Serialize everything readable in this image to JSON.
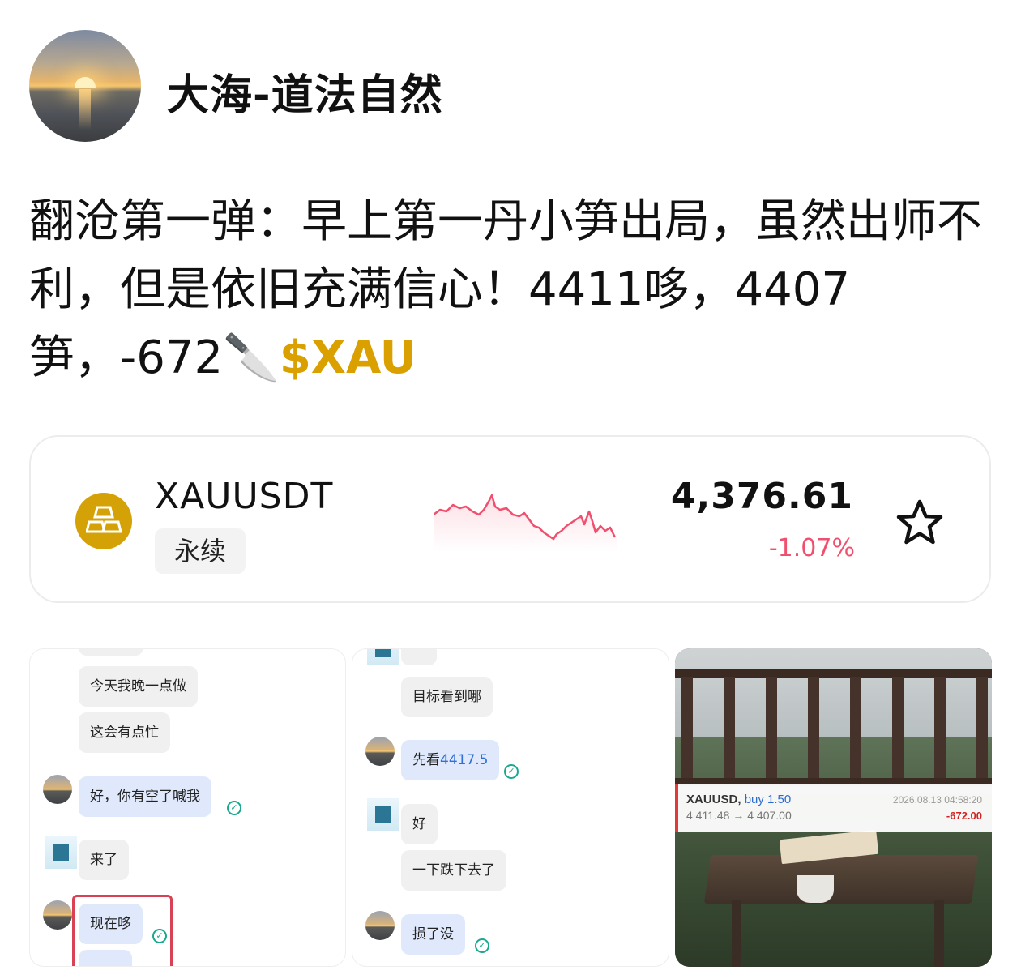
{
  "header": {
    "username": "大海-道法自然"
  },
  "post": {
    "text": "翻沧第一弹：早上第一丹小笋出局，虽然出师不利，但是依旧充满信心！4411哆，4407笋，-672🔪",
    "ticker": "$XAU"
  },
  "ticker_card": {
    "symbol": "XAUUSDT",
    "tag": "永续",
    "price": "4,376.61",
    "change": "-1.07%",
    "colors": {
      "coin": "#d4a106",
      "down": "#f0506e"
    },
    "icons": {
      "coin": "gold-bars-icon",
      "favorite": "star-outline-icon"
    }
  },
  "chat1": {
    "msgs": [
      {
        "text": "今天我晚一点做"
      },
      {
        "text": "这会有点忙"
      },
      {
        "text": "好，你有空了喊我"
      },
      {
        "text": "来了"
      },
      {
        "text": "现在哆"
      }
    ]
  },
  "chat2": {
    "msgs": [
      {
        "text": "目标看到哪"
      },
      {
        "text": "先看"
      },
      {
        "text": "4417.5"
      },
      {
        "text": "好"
      },
      {
        "text": "一下跌下去了"
      },
      {
        "text": "损了没"
      }
    ]
  },
  "trade": {
    "symbol": "XAUUSD,",
    "side": "buy 1.50",
    "path": "4 411.48 → 4 407.00",
    "date": "2026.08.13 04:58:20",
    "pl": "-672.00"
  }
}
